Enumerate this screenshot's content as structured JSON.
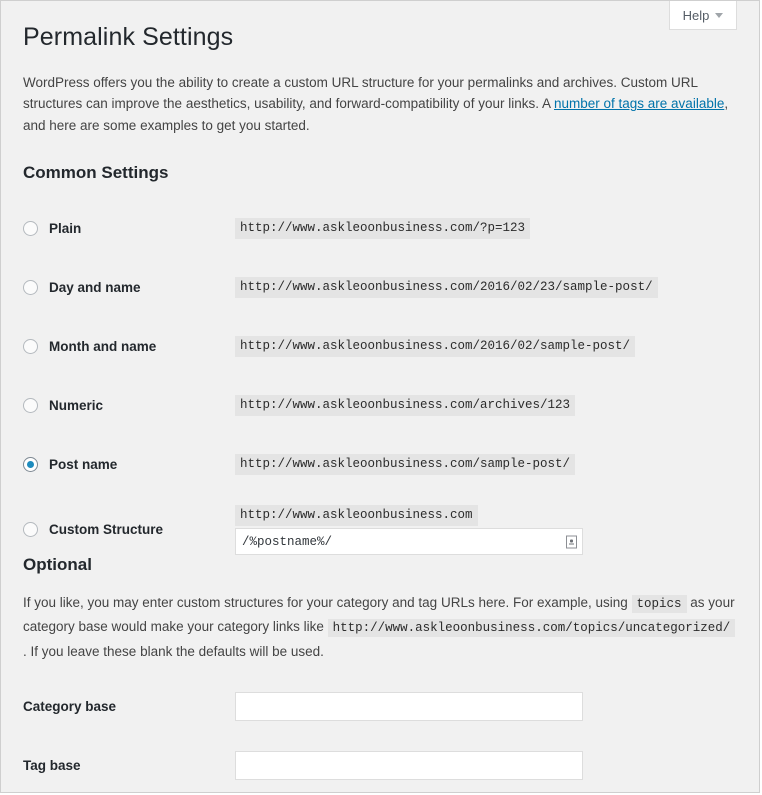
{
  "header": {
    "title": "Permalink Settings",
    "help_label": "Help",
    "help_caret": "chevron-down-icon"
  },
  "intro": {
    "text_before_link": "WordPress offers you the ability to create a custom URL structure for your permalinks and archives. Custom URL structures can improve the aesthetics, usability, and forward-compatibility of your links. A ",
    "link_text": "number of tags are available",
    "text_after_link": ", and here are some examples to get you started.",
    "link_color": "#0073aa"
  },
  "common_settings": {
    "heading": "Common Settings",
    "options": [
      {
        "id": "plain",
        "label": "Plain",
        "example": "http://www.askleoonbusiness.com/?p=123",
        "selected": false
      },
      {
        "id": "day-and-name",
        "label": "Day and name",
        "example": "http://www.askleoonbusiness.com/2016/02/23/sample-post/",
        "selected": false
      },
      {
        "id": "month-and-name",
        "label": "Month and name",
        "example": "http://www.askleoonbusiness.com/2016/02/sample-post/",
        "selected": false
      },
      {
        "id": "numeric",
        "label": "Numeric",
        "example": "http://www.askleoonbusiness.com/archives/123",
        "selected": false
      },
      {
        "id": "post-name",
        "label": "Post name",
        "example": "http://www.askleoonbusiness.com/sample-post/",
        "selected": true
      }
    ],
    "custom_structure": {
      "label": "Custom Structure",
      "selected": false,
      "base_url": "http://www.askleoonbusiness.com",
      "value": "/%postname%/",
      "grip_icon": "resize-grip-icon"
    }
  },
  "optional": {
    "heading": "Optional",
    "text_part1": "If you like, you may enter custom structures for your category and tag URLs here. For example, using ",
    "chip1": "topics",
    "text_part2": " as your category base would make your category links like ",
    "chip2": "http://www.askleoonbusiness.com/topics/uncategorized/",
    "text_part3": " . If you leave these blank the defaults will be used.",
    "fields": [
      {
        "id": "category-base",
        "label": "Category base",
        "value": "",
        "placeholder": ""
      },
      {
        "id": "tag-base",
        "label": "Tag base",
        "value": "",
        "placeholder": ""
      }
    ]
  },
  "theme": {
    "background": "#f1f1f1",
    "code_background": "#e4e4e4",
    "radio_accent": "#1e8cbe",
    "text": "#23282d"
  }
}
